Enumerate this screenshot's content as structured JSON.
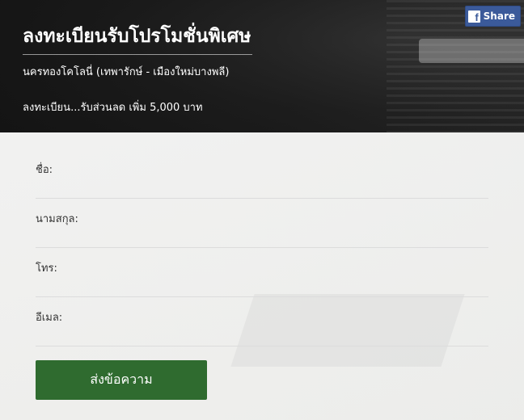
{
  "share": {
    "label": "Share",
    "icon": "facebook-icon",
    "color": "#3b5a9a"
  },
  "header": {
    "title": "ลงทะเบียนรับโปรโมชั่นพิเศษ",
    "subtitle": "นครทองโคโลนี่ (เทพารักษ์ - เมืองใหม่บางพลี)",
    "promo": "ลงทะเบียน...รับส่วนลด เพิ่ม 5,000 บาท"
  },
  "form": {
    "fields": [
      {
        "label": "ชื่อ:",
        "value": ""
      },
      {
        "label": "นามสกุล:",
        "value": ""
      },
      {
        "label": "โทร:",
        "value": ""
      },
      {
        "label": "อีเมล:",
        "value": ""
      }
    ],
    "submit_label": "ส่งข้อความ",
    "submit_color": "#2f6b2f"
  }
}
